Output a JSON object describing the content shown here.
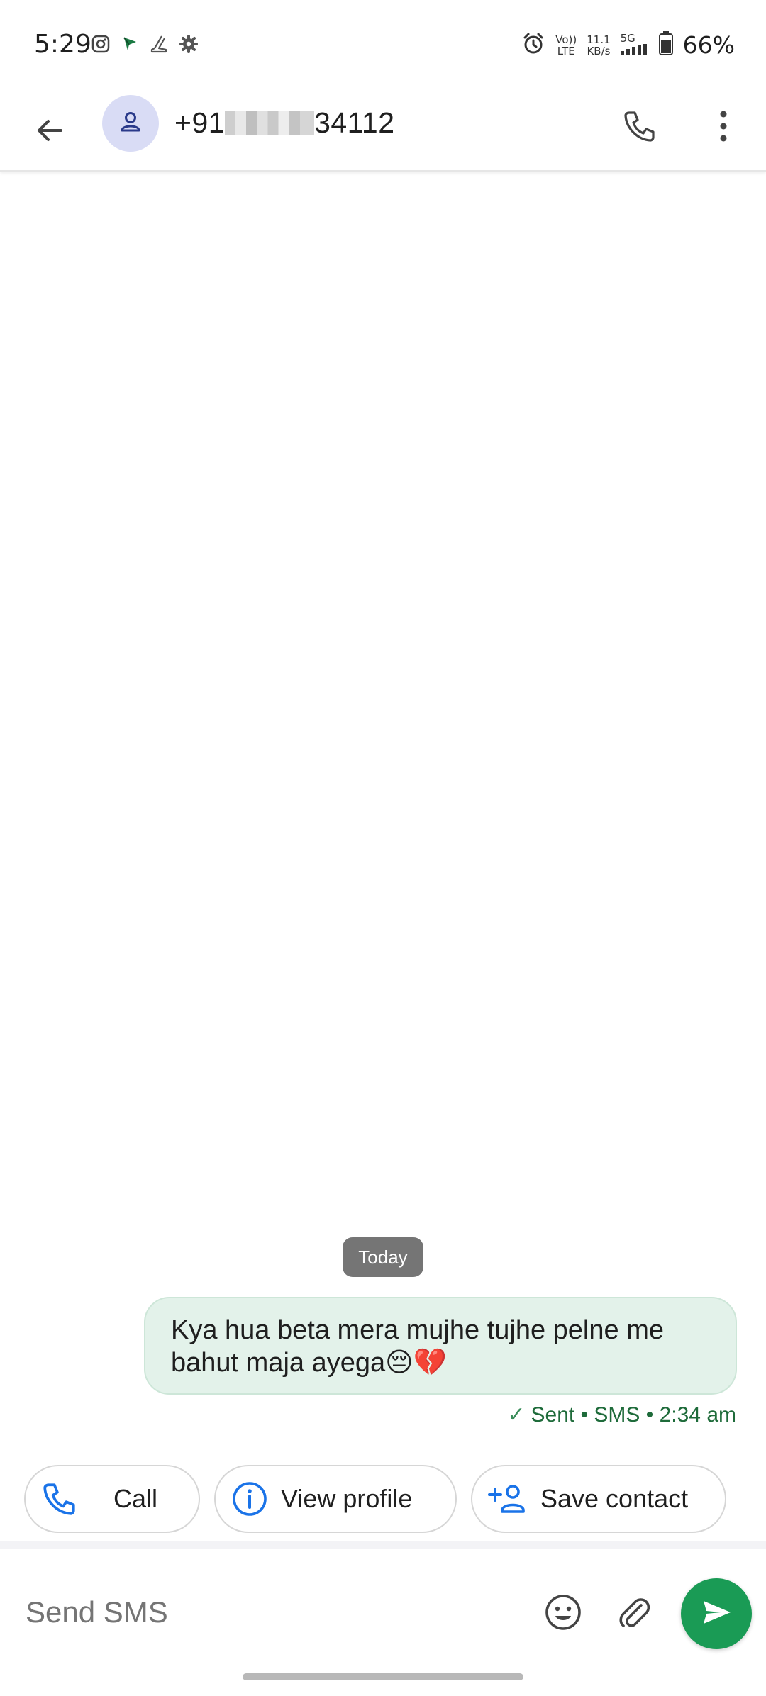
{
  "status_bar": {
    "time": "5:29",
    "volte_top": "Vo))",
    "volte_bottom": "LTE",
    "speed_top": "11.1",
    "speed_bottom": "KB/s",
    "network": "5G",
    "battery": "66%",
    "icons": [
      "instagram-icon",
      "flag-icon",
      "boot-icon",
      "settings-icon",
      "alarm-icon",
      "signal-icon",
      "battery-icon"
    ]
  },
  "app_bar": {
    "title_prefix": "+91",
    "title_suffix": "34112",
    "icons": [
      "back-arrow-icon",
      "person-icon",
      "phone-icon",
      "more-vert-icon"
    ]
  },
  "conversation": {
    "date_label": "Today",
    "messages": [
      {
        "text": "Kya hua beta mera mujhe tujhe pelne me bahut maja ayega😔💔",
        "status": "Sent • SMS • 2:34 am",
        "direction": "outgoing"
      }
    ]
  },
  "suggestions": {
    "call_label": "Call",
    "view_profile_label": "View profile",
    "save_contact_label": "Save contact"
  },
  "compose": {
    "placeholder": "Send SMS",
    "icons": [
      "emoji-icon",
      "attach-icon",
      "send-icon"
    ]
  },
  "colors": {
    "bubble_bg": "#e3f2ea",
    "status_text": "#1e6b3a",
    "send_button": "#1a9b55",
    "chip_icon": "#1a73e8",
    "avatar_bg": "#d9dcf5"
  }
}
